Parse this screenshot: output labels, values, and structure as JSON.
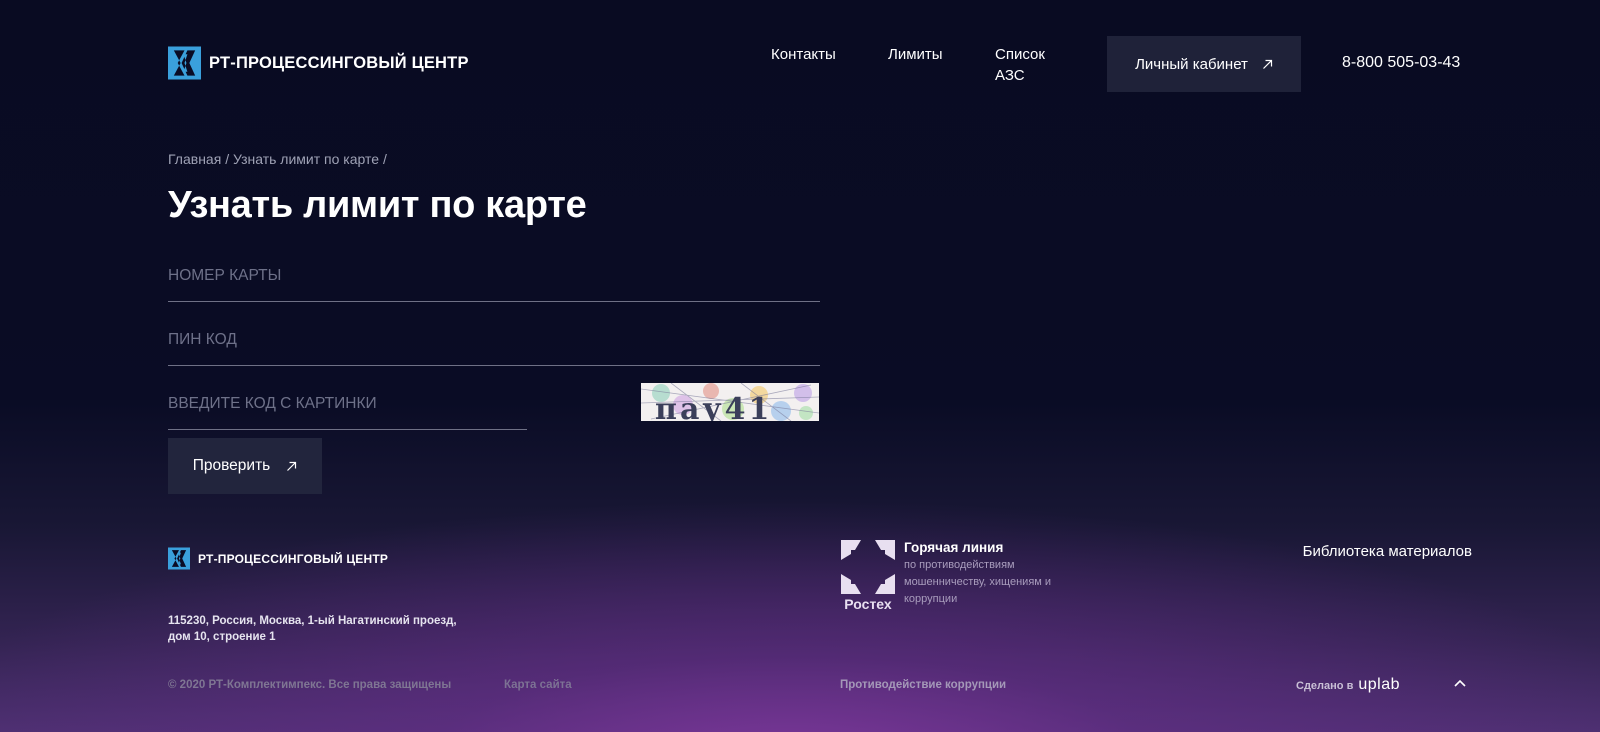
{
  "header": {
    "logo_text": "РТ-ПРОЦЕССИНГОВЫЙ ЦЕНТР",
    "nav": [
      {
        "label": "Контакты"
      },
      {
        "label": "Лимиты"
      },
      {
        "label_line1": "Список",
        "label_line2": "АЗС"
      }
    ],
    "cabinet_label": "Личный кабинет",
    "phone": "8-800 505-03-43"
  },
  "breadcrumb": {
    "items": [
      "Главная",
      "Узнать лимит по карте"
    ],
    "separator": "/"
  },
  "page_title": "Узнать лимит по карте",
  "form": {
    "card_placeholder": "Номер карты",
    "card_value": "",
    "pin_placeholder": "Пин код",
    "pin_value": "",
    "captcha_placeholder": "Введите код с картинки",
    "captcha_value": "",
    "captcha_text": "пау41",
    "submit_label": "Проверить"
  },
  "footer": {
    "logo_text": "РТ-ПРОЦЕССИНГОВЫЙ ЦЕНТР",
    "address_line1": "115230, Россия, Москва, 1-ый Нагатинский проезд,",
    "address_line2": "дом 10, строение 1",
    "rostec_name": "Ростех",
    "hotline_title": "Горячая линия",
    "hotline_sub": "по противодействиям мошенничеству, хищениям и коррупции",
    "library": "Библиотека материалов",
    "copyright": "© 2020 РТ-Комплектимпекс. Все права защищены",
    "sitemap": "Карта сайта",
    "anticorruption": "Противодействие коррупции",
    "made_by_label": "Сделано в",
    "made_by_brand": "uplab"
  },
  "colors": {
    "background": "#090b22",
    "button_bg": "#1f2239",
    "logo_blue": "#3aa0dc",
    "rostec_accent": "#e8dff0"
  }
}
